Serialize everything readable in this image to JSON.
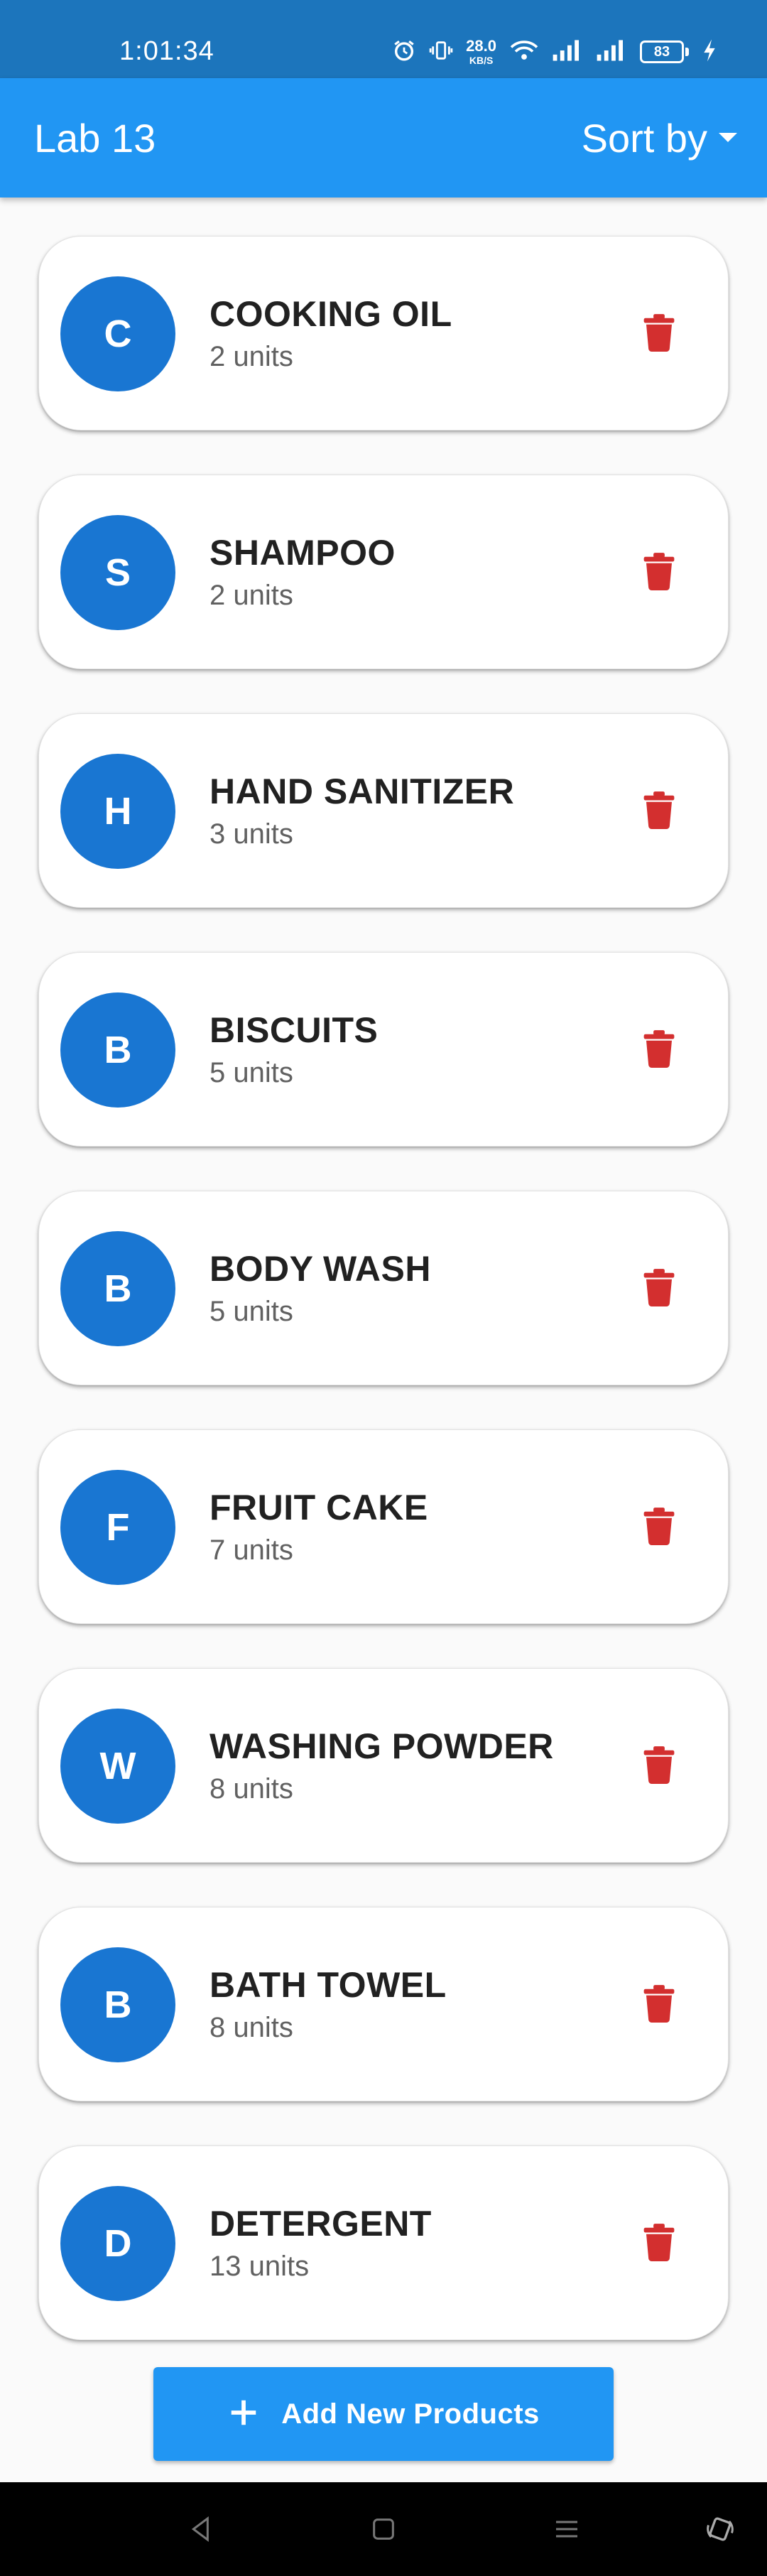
{
  "status_bar": {
    "time": "1:01:34",
    "net_speed": "28.0",
    "net_speed_unit": "KB/S",
    "battery": "83"
  },
  "app_bar": {
    "title": "Lab 13",
    "sort_label": "Sort by"
  },
  "products": [
    {
      "initial": "C",
      "name": "COOKING OIL",
      "quantity": "2 units"
    },
    {
      "initial": "S",
      "name": "SHAMPOO",
      "quantity": "2 units"
    },
    {
      "initial": "H",
      "name": "HAND SANITIZER",
      "quantity": "3 units"
    },
    {
      "initial": "B",
      "name": "BISCUITS",
      "quantity": "5 units"
    },
    {
      "initial": "B",
      "name": "BODY WASH",
      "quantity": "5 units"
    },
    {
      "initial": "F",
      "name": "FRUIT CAKE",
      "quantity": "7 units"
    },
    {
      "initial": "W",
      "name": "WASHING POWDER",
      "quantity": "8 units"
    },
    {
      "initial": "B",
      "name": "BATH TOWEL",
      "quantity": "8 units"
    },
    {
      "initial": "D",
      "name": "DETERGENT",
      "quantity": "13 units"
    }
  ],
  "add_button": {
    "label": "Add New Products"
  },
  "colors": {
    "primary": "#2196F3",
    "status_bar": "#1C75BC",
    "avatar": "#1976D2",
    "delete": "#D32F2F"
  },
  "icons": {
    "sort": "arrow-drop-down-icon",
    "delete": "trash-icon",
    "add": "plus-icon",
    "nav": [
      "back-icon",
      "home-icon",
      "recents-icon",
      "rotate-icon"
    ]
  }
}
